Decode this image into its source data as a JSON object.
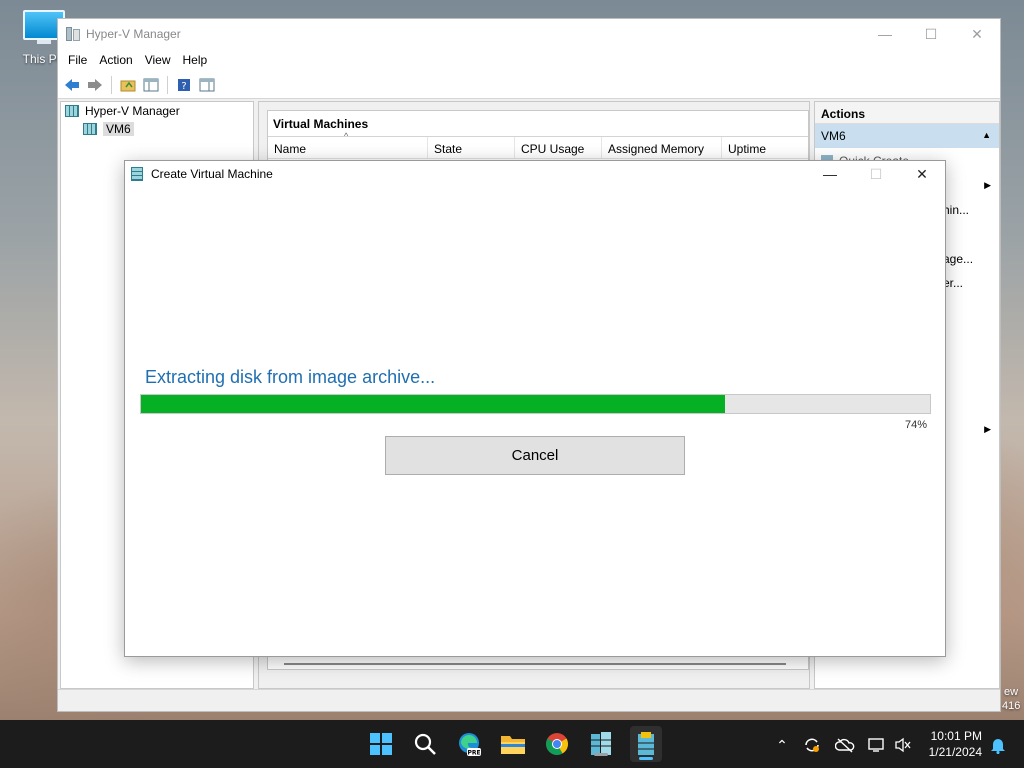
{
  "desktop": {
    "icon_label": "This PC",
    "edge_text": [
      "ew",
      "416"
    ]
  },
  "hyperv": {
    "title": "Hyper-V Manager",
    "window_controls": {
      "minimize": "—",
      "maximize": "☐",
      "close": "✕"
    },
    "menu": [
      "File",
      "Action",
      "View",
      "Help"
    ],
    "tree": [
      {
        "label": "Hyper-V Manager",
        "selected": false
      },
      {
        "label": "VM6",
        "selected": true
      }
    ],
    "vm_panel_title": "Virtual Machines",
    "vm_columns": [
      "Name",
      "State",
      "CPU Usage",
      "Assigned Memory",
      "Uptime"
    ],
    "actions": {
      "title": "Actions",
      "selected": "VM6",
      "items": [
        "Quick Create...",
        "hin...",
        "age...",
        "er..."
      ]
    }
  },
  "dialog": {
    "title": "Create Virtual Machine",
    "status_text": "Extracting disk from image archive...",
    "progress_percent": 74,
    "progress_label": "74%",
    "cancel_label": "Cancel",
    "controls": {
      "minimize": "—",
      "maximize": "☐",
      "close": "✕"
    }
  },
  "taskbar": {
    "time": "10:01 PM",
    "date": "1/21/2024",
    "pinned": [
      "start-icon",
      "search-icon",
      "edge-preview-icon",
      "file-explorer-icon",
      "chrome-icon",
      "hyperv-manager-icon",
      "create-vm-icon"
    ]
  },
  "colors": {
    "progress_fill": "#06b025",
    "progress_text": "#1f6fb2",
    "selection": "#c9dff0"
  }
}
